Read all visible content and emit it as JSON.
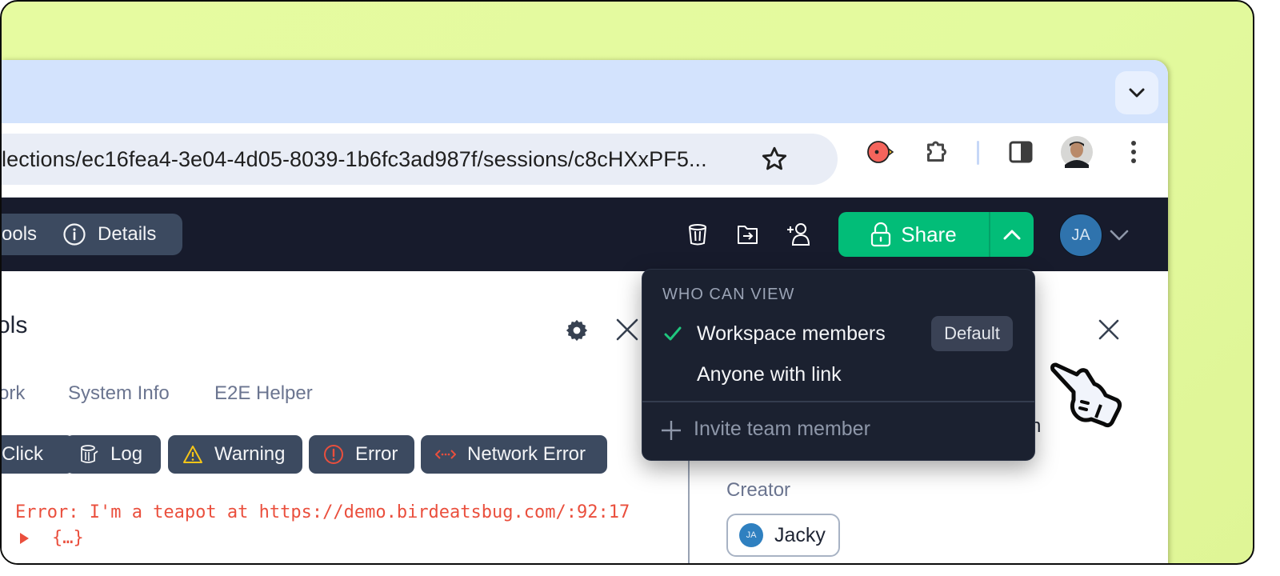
{
  "browser": {
    "url": "lections/ec16fea4-3e04-4d05-8039-1b6fc3ad987f/sessions/c8cHXxPF5...",
    "icons": [
      "tab-search-dropdown-icon",
      "bookmark-star-icon",
      "birdeatsbug-extension-icon",
      "extensions-puzzle-icon",
      "side-panel-icon",
      "profile-avatar",
      "more-menu-icon"
    ]
  },
  "appbar": {
    "tools_tab": "ools",
    "details_tab": "Details",
    "share_label": "Share",
    "avatar_initials": "JA"
  },
  "devtools": {
    "title": "ols",
    "tabs": [
      "ork",
      "System Info",
      "E2E Helper"
    ],
    "filters": [
      {
        "label": "Click",
        "icon": "click-icon"
      },
      {
        "label": "Log",
        "icon": "log-icon"
      },
      {
        "label": "Warning",
        "icon": "warning-icon"
      },
      {
        "label": "Error",
        "icon": "error-icon"
      },
      {
        "label": "Network Error",
        "icon": "network-error-icon"
      }
    ],
    "log_lines": [
      "Error: I'm a teapot at https://demo.birdeatsbug.com/:92:17",
      "{…}"
    ]
  },
  "details": {
    "partial_text": "n",
    "creator_label": "Creator",
    "creator_name": "Jacky",
    "creator_initials": "JA"
  },
  "share_menu": {
    "heading": "WHO CAN VIEW",
    "options": [
      {
        "label": "Workspace members",
        "selected": true,
        "badge": "Default"
      },
      {
        "label": "Anyone with link",
        "selected": false
      }
    ],
    "invite_label": "Invite team member"
  },
  "colors": {
    "accent_green": "#02bd78",
    "appbar_bg": "#171b2c",
    "error_red": "#ea4f3d",
    "warning_yellow": "#f5c518",
    "backdrop": "#e4fa9e"
  }
}
